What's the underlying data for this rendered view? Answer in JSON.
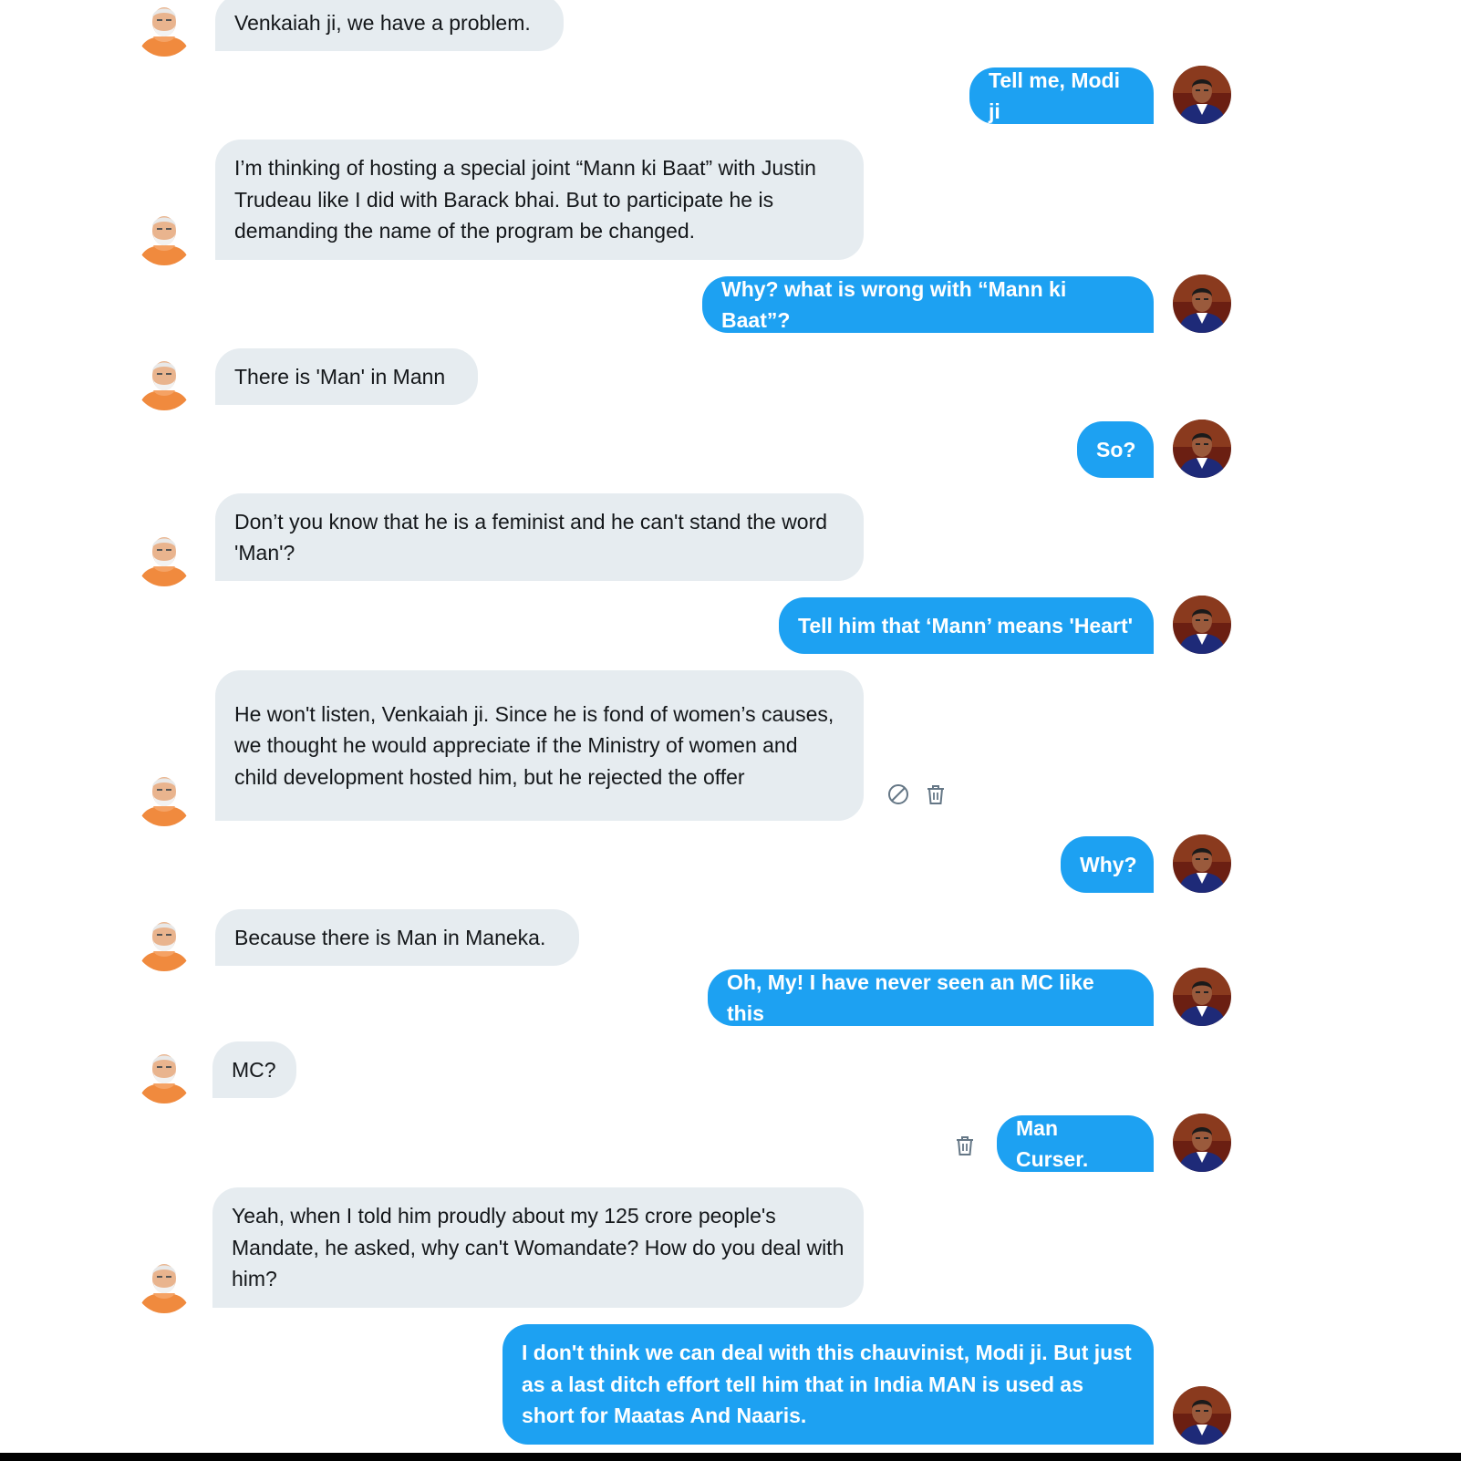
{
  "conversation": {
    "messages": [
      {
        "side": "in",
        "text": "Venkaiah ji, we have a problem."
      },
      {
        "side": "out",
        "text": "Tell me, Modi ji"
      },
      {
        "side": "in",
        "text": "I’m thinking of hosting a special joint “Mann ki Baat” with Justin Trudeau like I did with Barack bhai. But to participate he is demanding the name of the program be changed."
      },
      {
        "side": "out",
        "text": "Why? what is wrong with “Mann ki Baat”?"
      },
      {
        "side": "in",
        "text": "There is 'Man' in Mann"
      },
      {
        "side": "out",
        "text": "So?"
      },
      {
        "side": "in",
        "text": "Don’t you know that he is a feminist and he can't stand the word 'Man'?"
      },
      {
        "side": "out",
        "text": "Tell him that ‘Mann’ means 'Heart'"
      },
      {
        "side": "in",
        "text": "He won't listen, Venkaiah ji. Since he is fond of women’s causes, we thought he would appreciate if the Ministry of women and child development hosted him, but he rejected the offer",
        "actions": [
          "report-icon",
          "trash-icon"
        ]
      },
      {
        "side": "out",
        "text": "Why?"
      },
      {
        "side": "in",
        "text": "Because there is Man in Maneka."
      },
      {
        "side": "out",
        "text": "Oh, My! I have never seen an MC like this"
      },
      {
        "side": "in",
        "text": "MC?"
      },
      {
        "side": "out",
        "text": "Man Curser.",
        "actions": [
          "trash-icon"
        ]
      },
      {
        "side": "in",
        "text": "Yeah, when I told him proudly about my 125 crore people's Mandate, he asked, why can't Womandate? How do you deal with him?"
      },
      {
        "side": "out",
        "text": "I don't think we can deal with this chauvinist, Modi ji. But just as a last ditch effort tell him that in India MAN is used as short for Maatas And Naaris."
      }
    ]
  },
  "colors": {
    "incoming_bubble": "#e6ecf0",
    "outgoing_bubble": "#1da1f2",
    "incoming_text": "#14171a",
    "outgoing_text": "#ffffff",
    "icon": "#657786"
  },
  "icons": {
    "incoming_avatar": "avatar-modi-icon",
    "outgoing_avatar": "avatar-venkaiah-icon"
  }
}
